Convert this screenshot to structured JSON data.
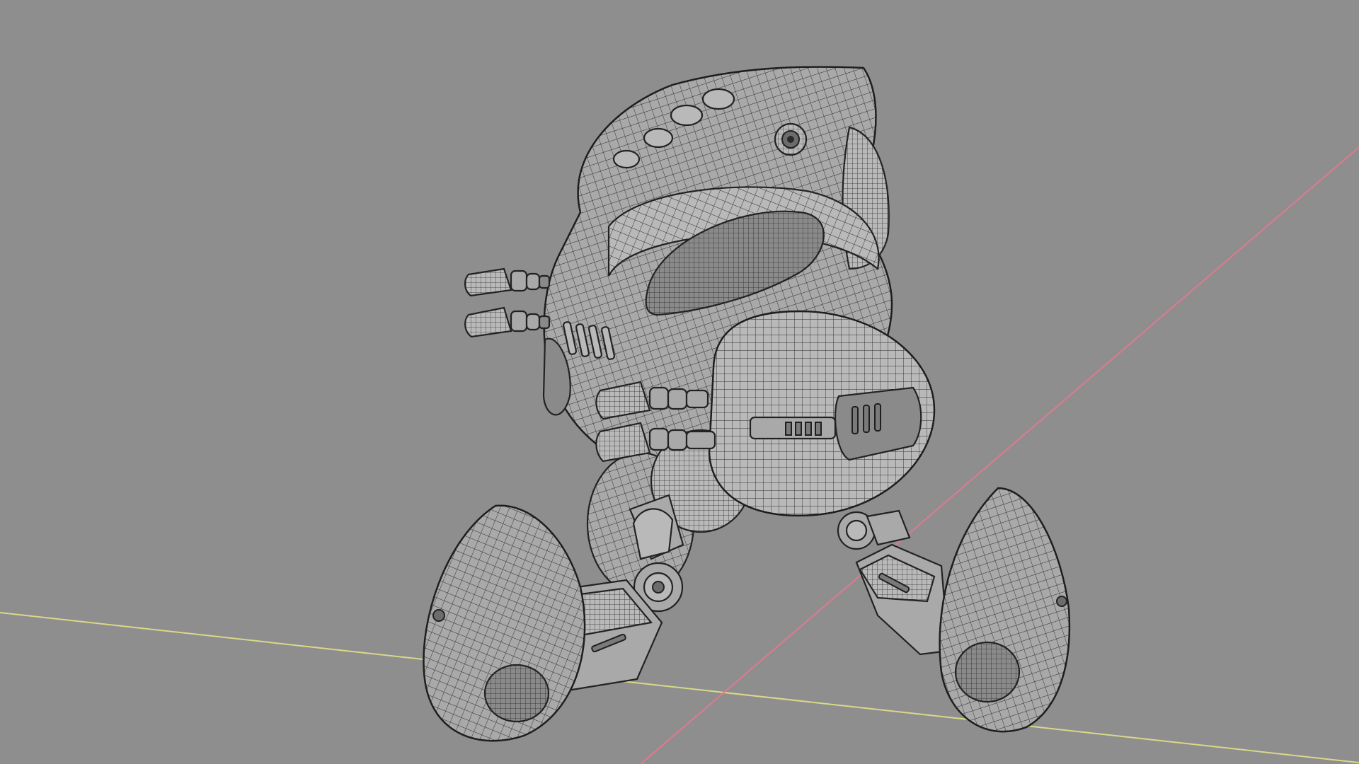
{
  "viewport": {
    "background": "#8e8e8e",
    "shading": "wireframe-on-solid",
    "axis_colors": {
      "x_axis": "#d9d98a",
      "y_axis": "#e07a8e"
    }
  },
  "scene": {
    "object": "robot-mesh",
    "parts": [
      "body-shell",
      "head-crest",
      "front-pod",
      "left-foot",
      "right-foot",
      "thrusters",
      "joints"
    ]
  }
}
